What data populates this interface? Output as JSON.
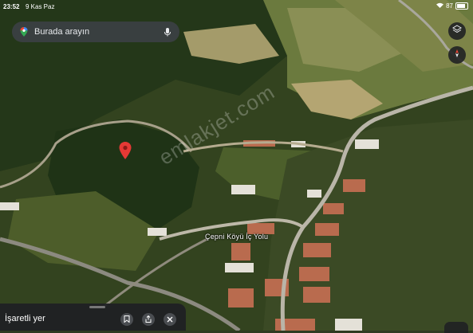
{
  "status_bar": {
    "time": "23:52",
    "date": "9 Kas Paz",
    "battery": "87"
  },
  "search": {
    "placeholder": "Burada arayın"
  },
  "map": {
    "road_label": "Çepni Köyü İç Yolu",
    "watermark": "emlakjet.com"
  },
  "bottom_sheet": {
    "label": "İşaretli yer"
  },
  "colors": {
    "pin": "#e53935",
    "panel": "#202124",
    "panel_text": "#e8eaed"
  }
}
